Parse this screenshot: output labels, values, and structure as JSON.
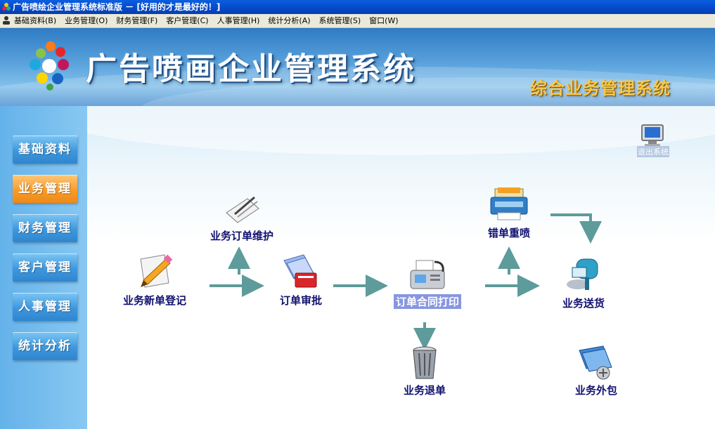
{
  "window": {
    "title": "广告喷绘企业管理系统标准版 － [好用的才是最好的！]"
  },
  "menubar": {
    "items": [
      "基础资料(B)",
      "业务管理(O)",
      "财务管理(F)",
      "客户管理(C)",
      "人事管理(H)",
      "统计分析(A)",
      "系统管理(S)",
      "窗口(W)"
    ]
  },
  "banner": {
    "title": "广告喷画企业管理系统",
    "subtitle": "综合业务管理系统"
  },
  "sidebar": {
    "items": [
      "基础资料",
      "业务管理",
      "财务管理",
      "客户管理",
      "人事管理",
      "统计分析"
    ],
    "active": "业务管理"
  },
  "exit": {
    "label": "退出系统"
  },
  "workflow": {
    "new_order": "业务新单登记",
    "order_maintain": "业务订单维护",
    "order_approve": "订单审批",
    "contract_print": "订单合同打印",
    "reprint": "错单重喷",
    "delivery": "业务送货",
    "return": "业务退单",
    "outsource": "业务外包"
  },
  "colors": {
    "arrow": "#5e9b9b",
    "active_nav": "#f89b2a",
    "nav": "#3e97dd",
    "label": "#101070"
  }
}
